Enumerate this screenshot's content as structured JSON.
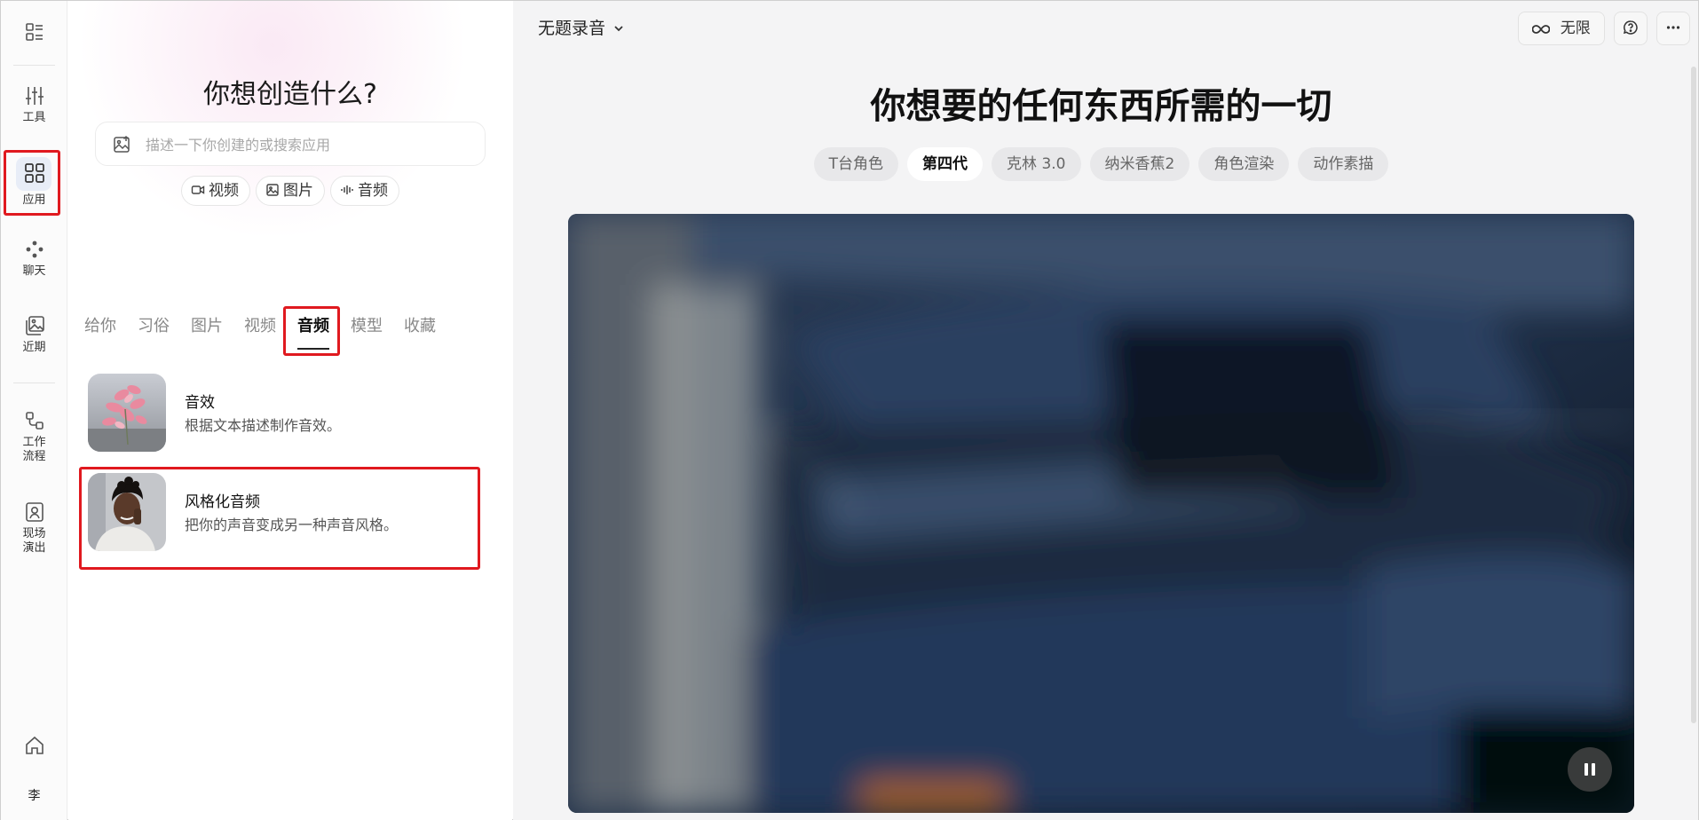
{
  "rail": {
    "items": [
      {
        "label": "",
        "icon": "layout-list-icon"
      },
      {
        "label": "工具",
        "icon": "sliders-icon"
      },
      {
        "label": "应用",
        "icon": "apps-grid-icon"
      },
      {
        "label": "聊天",
        "icon": "chat-nodes-icon"
      },
      {
        "label": "近期",
        "icon": "image-stack-icon"
      },
      {
        "label": "工作\n流程",
        "icon": "workflow-icon"
      },
      {
        "label": "现场\n演出",
        "icon": "portrait-icon"
      },
      {
        "label": "",
        "icon": "home-icon"
      },
      {
        "label": "李",
        "icon": "avatar"
      }
    ],
    "active_index": 2
  },
  "panel": {
    "title": "你想创造什么?",
    "search_placeholder": "描述一下你创建的或搜索应用",
    "chips": [
      {
        "label": "视频",
        "icon": "video-icon"
      },
      {
        "label": "图片",
        "icon": "image-icon"
      },
      {
        "label": "音频",
        "icon": "audio-wave-icon"
      }
    ],
    "tabs": [
      "给你",
      "习俗",
      "图片",
      "视频",
      "音频",
      "模型",
      "收藏"
    ],
    "active_tab": "音频",
    "apps": [
      {
        "name": "音效",
        "desc": "根据文本描述制作音效。",
        "thumb": "pink-flower-thumb"
      },
      {
        "name": "风格化音频",
        "desc": "把你的声音变成另一种声音风格。",
        "thumb": "woman-portrait-thumb"
      }
    ]
  },
  "main": {
    "doc_title": "无题录音",
    "top_buttons": {
      "infinite_label": "无限"
    },
    "hero_title": "你想要的任何东西所需的一切",
    "pills": [
      "T台角色",
      "第四代",
      "克林 3.0",
      "纳米香蕉2",
      "角色渲染",
      "动作素描"
    ],
    "active_pill": "第四代",
    "video": {
      "state": "playing"
    }
  },
  "colors": {
    "highlight_box": "#e0191f",
    "main_bg": "#f4f4f5",
    "active_rail_bg": "#e8edf7"
  }
}
